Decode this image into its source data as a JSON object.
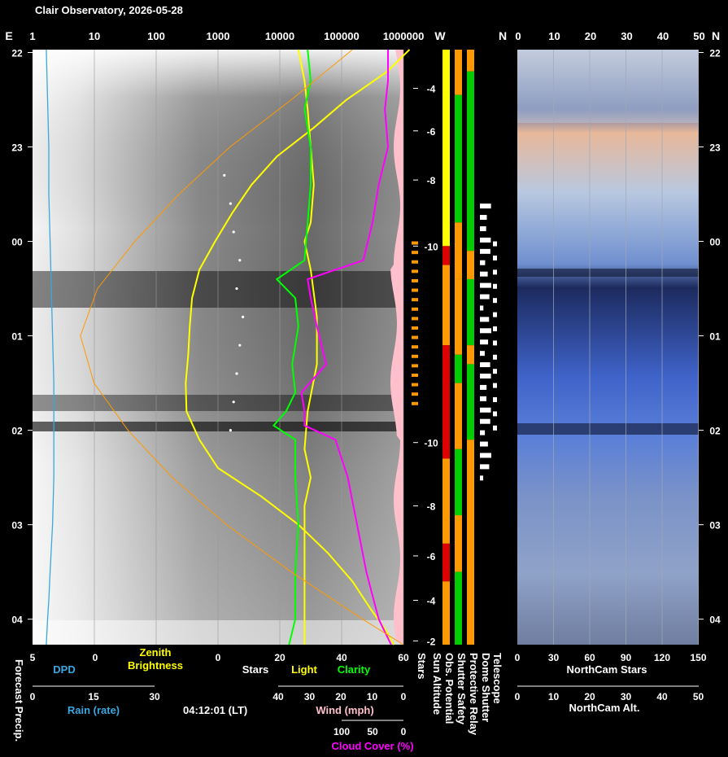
{
  "title": "Clair Observatory, 2026-05-28",
  "timestamp": "04:12:01 (LT)",
  "colors": {
    "dpd": "#3aa7e0",
    "zenith": "#ffff00",
    "sun_altitude": "#ff9900",
    "stars": "#ffffff",
    "clarity": "#00ff00",
    "light": "#ffff00",
    "cloud_cover": "#ff00ff",
    "wind": "#ffc0cb",
    "good": "#00cc00",
    "warn": "#ff9900",
    "bad": "#dd0000",
    "unknown": "#ffff00"
  },
  "chart_data": {
    "type": "line",
    "time_axis": {
      "ticks": [
        "22",
        "23",
        "00",
        "01",
        "02",
        "03",
        "04"
      ],
      "start_hour": 21.97,
      "end_hour": 28.27
    },
    "top_axis": {
      "left_letter": "E",
      "log_ticks": [
        "1",
        "10",
        "100",
        "1000",
        "10000",
        "100000",
        "1000000"
      ],
      "w_letter": "W",
      "n_letter": "N",
      "right_ticks": [
        "0",
        "10",
        "20",
        "30",
        "40",
        "50"
      ],
      "far_right_letter": "N"
    },
    "bottom_axes": {
      "dpd": {
        "label": "DPD",
        "ticks": [
          "5",
          "0"
        ]
      },
      "zenith": {
        "label_line1": "Zenith",
        "label_line2": "Brightness"
      },
      "stars": {
        "label": "Stars",
        "ticks": [
          "0",
          "20",
          "40",
          "60"
        ]
      },
      "light": {
        "label": "Light"
      },
      "clarity": {
        "label": "Clarity"
      },
      "rain": {
        "label": "Rain (rate)",
        "ticks": [
          "0",
          "15",
          "30"
        ]
      },
      "wind": {
        "label": "Wind (mph)",
        "ticks": [
          "40",
          "30",
          "20",
          "10",
          "0"
        ]
      },
      "cloud": {
        "label": "Cloud Cover (%)",
        "ticks": [
          "100",
          "50",
          "0"
        ]
      },
      "forecast": {
        "label": "Forecast Precip."
      },
      "northcam_stars": {
        "label": "NorthCam Stars",
        "ticks": [
          "0",
          "30",
          "60",
          "90",
          "120",
          "150"
        ]
      },
      "northcam_alt": {
        "label": "NorthCam Alt.",
        "ticks": [
          "0",
          "10",
          "20",
          "30",
          "40",
          "50"
        ]
      }
    },
    "vertical_labels": [
      "Stars",
      "Sun Altitude",
      "Obs. Potential",
      "Shutter Safety",
      "Protective Relay",
      "Dome Shutter",
      "Telescope"
    ],
    "sun_altitude_ticks": [
      {
        "label": "-4",
        "hour": 22.38
      },
      {
        "label": "-6",
        "hour": 22.83
      },
      {
        "label": "-8",
        "hour": 23.35
      },
      {
        "label": "-10",
        "hour": 24.05
      },
      {
        "label": "-10",
        "hour": 26.13
      },
      {
        "label": "-8",
        "hour": 26.8
      },
      {
        "label": "-6",
        "hour": 27.33
      },
      {
        "label": "-4",
        "hour": 27.8
      },
      {
        "label": "-2",
        "hour": 28.23
      }
    ],
    "series": [
      {
        "name": "DPD",
        "x_hour": [
          21.97,
          22.5,
          23.0,
          23.5,
          24.0,
          24.5,
          25.0,
          25.5,
          26.0,
          26.5,
          27.0,
          27.5,
          27.8,
          28.0,
          28.27
        ],
        "values": [
          3.9,
          3.8,
          3.7,
          3.7,
          3.6,
          3.5,
          3.4,
          3.3,
          3.3,
          3.3,
          3.4,
          3.6,
          3.7,
          3.8,
          3.9
        ]
      },
      {
        "name": "Zenith Brightness",
        "x_hour": [
          21.97,
          22.2,
          22.5,
          22.8,
          23.1,
          23.4,
          23.7,
          24.0,
          24.3,
          24.6,
          24.9,
          25.2,
          25.5,
          25.8,
          26.1,
          26.4,
          26.7,
          27.0,
          27.3,
          27.6,
          27.9,
          28.1,
          28.27
        ],
        "values": [
          1250000,
          550000,
          120000,
          35000,
          9000,
          3500,
          1700,
          900,
          500,
          380,
          350,
          330,
          300,
          310,
          500,
          1000,
          5000,
          20000,
          60000,
          150000,
          300000,
          500000,
          700000
        ]
      },
      {
        "name": "Stars",
        "x_hour": [
          23.3,
          23.6,
          23.9,
          24.2,
          24.5,
          24.8,
          25.1,
          25.4,
          25.7,
          26.0
        ],
        "values": [
          1,
          3,
          4,
          6,
          5,
          7,
          6,
          5,
          4,
          3
        ]
      },
      {
        "name": "Light",
        "x_hour": [
          21.97,
          22.3,
          22.6,
          23.0,
          23.4,
          23.8,
          24.0,
          24.3,
          24.8,
          25.3,
          25.8,
          26.2,
          26.5,
          26.8,
          27.0,
          27.3,
          27.6,
          27.9,
          28.27
        ],
        "values": [
          26,
          28,
          29,
          30,
          31,
          30,
          28,
          30,
          32,
          32,
          29,
          28,
          30,
          28,
          28,
          28,
          28,
          28,
          28
        ]
      },
      {
        "name": "Clarity",
        "x_hour": [
          21.97,
          22.3,
          22.6,
          23.0,
          23.4,
          23.8,
          24.2,
          24.4,
          24.6,
          24.9,
          25.3,
          25.6,
          25.8,
          25.95,
          26.1,
          26.5,
          27.0,
          27.5,
          28.0,
          28.27
        ],
        "values": [
          29,
          30,
          28,
          30,
          30,
          29,
          28,
          19,
          25,
          26,
          24,
          25,
          22,
          18,
          25,
          25,
          26,
          25,
          25,
          23
        ]
      },
      {
        "name": "Cloud Cover",
        "x_hour": [
          21.97,
          22.3,
          22.6,
          23.0,
          23.4,
          23.8,
          24.2,
          24.4,
          24.6,
          24.9,
          25.3,
          25.6,
          25.8,
          25.95,
          26.1,
          26.5,
          27.0,
          27.5,
          28.0,
          28.27
        ],
        "values": [
          55,
          55,
          54,
          55,
          52,
          50,
          47,
          29,
          30,
          32,
          35,
          27,
          28,
          28,
          38,
          42,
          45,
          48,
          52,
          56
        ]
      },
      {
        "name": "Sun Altitude",
        "x_hour": [
          21.97,
          22.5,
          23.0,
          23.5,
          24.0,
          24.5,
          25.0,
          25.5,
          26.0,
          26.5,
          27.0,
          27.5,
          28.0,
          28.27
        ],
        "values": [
          -3.5,
          -5.3,
          -7.1,
          -8.6,
          -9.9,
          -11.0,
          -11.5,
          -11.1,
          -10.1,
          -8.8,
          -7.2,
          -5.3,
          -3.2,
          -2.0
        ]
      }
    ],
    "status_bars": {
      "obs_potential": {
        "name": "Obs. Potential",
        "segments": [
          {
            "from": 21.97,
            "to": 24.05,
            "state": "unknown"
          },
          {
            "from": 24.05,
            "to": 24.25,
            "state": "bad"
          },
          {
            "from": 24.25,
            "to": 25.1,
            "state": "warn"
          },
          {
            "from": 25.1,
            "to": 26.3,
            "state": "bad"
          },
          {
            "from": 26.3,
            "to": 27.2,
            "state": "warn"
          },
          {
            "from": 27.2,
            "to": 27.6,
            "state": "bad"
          },
          {
            "from": 27.6,
            "to": 28.27,
            "state": "warn"
          }
        ]
      },
      "shutter_safety": {
        "name": "Shutter Safety",
        "segments": [
          {
            "from": 21.97,
            "to": 22.45,
            "state": "warn"
          },
          {
            "from": 22.45,
            "to": 23.8,
            "state": "good"
          },
          {
            "from": 23.8,
            "to": 24.4,
            "state": "warn"
          },
          {
            "from": 24.4,
            "to": 25.2,
            "state": "warn"
          },
          {
            "from": 25.2,
            "to": 25.5,
            "state": "good"
          },
          {
            "from": 25.5,
            "to": 26.2,
            "state": "warn"
          },
          {
            "from": 26.2,
            "to": 26.9,
            "state": "good"
          },
          {
            "from": 26.9,
            "to": 27.5,
            "state": "warn"
          },
          {
            "from": 27.5,
            "to": 28.27,
            "state": "good"
          }
        ]
      },
      "protective_relay": {
        "name": "Protective Relay",
        "segments": [
          {
            "from": 21.97,
            "to": 22.2,
            "state": "warn"
          },
          {
            "from": 22.2,
            "to": 24.1,
            "state": "good"
          },
          {
            "from": 24.1,
            "to": 24.4,
            "state": "warn"
          },
          {
            "from": 24.4,
            "to": 25.1,
            "state": "good"
          },
          {
            "from": 25.1,
            "to": 25.3,
            "state": "warn"
          },
          {
            "from": 25.3,
            "to": 26.1,
            "state": "good"
          },
          {
            "from": 26.1,
            "to": 28.27,
            "state": "warn"
          }
        ]
      }
    }
  }
}
